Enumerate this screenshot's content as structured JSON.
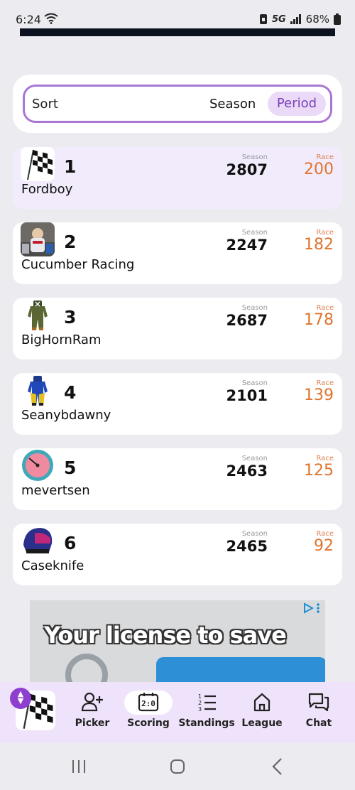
{
  "status": {
    "time": "6:24",
    "network": "5G",
    "battery": "68%"
  },
  "sort": {
    "label": "Sort",
    "options": [
      "Season",
      "Period"
    ],
    "selected": "Period"
  },
  "labels": {
    "season": "Season",
    "race": "Race"
  },
  "standings": [
    {
      "rank": "1",
      "name": "Fordboy",
      "season": "2807",
      "race": "200",
      "avatar": "checkered-flag"
    },
    {
      "rank": "2",
      "name": "Cucumber Racing",
      "season": "2247",
      "race": "182",
      "avatar": "driver-photo"
    },
    {
      "rank": "3",
      "name": "BigHornRam",
      "season": "2687",
      "race": "178",
      "avatar": "firesuit-green"
    },
    {
      "rank": "4",
      "name": "Seanybdawny",
      "season": "2101",
      "race": "139",
      "avatar": "firesuit-blue-yellow"
    },
    {
      "rank": "5",
      "name": "mevertsen",
      "season": "2463",
      "race": "125",
      "avatar": "gauge-fantrax"
    },
    {
      "rank": "6",
      "name": "Caseknife",
      "season": "2465",
      "race": "92",
      "avatar": "helmet-fantrax"
    }
  ],
  "ad": {
    "headline": "Your license to save"
  },
  "nav": {
    "items": [
      {
        "label": "Picker",
        "icon": "add-user-icon"
      },
      {
        "label": "Scoring",
        "icon": "scoreboard-icon"
      },
      {
        "label": "Standings",
        "icon": "ordered-list-icon"
      },
      {
        "label": "League",
        "icon": "home-icon"
      },
      {
        "label": "Chat",
        "icon": "chat-icon"
      }
    ],
    "active": "Scoring"
  },
  "colors": {
    "accent": "#8e3fd0",
    "race": "#e0742e",
    "nav_bg": "#efe2fb"
  }
}
